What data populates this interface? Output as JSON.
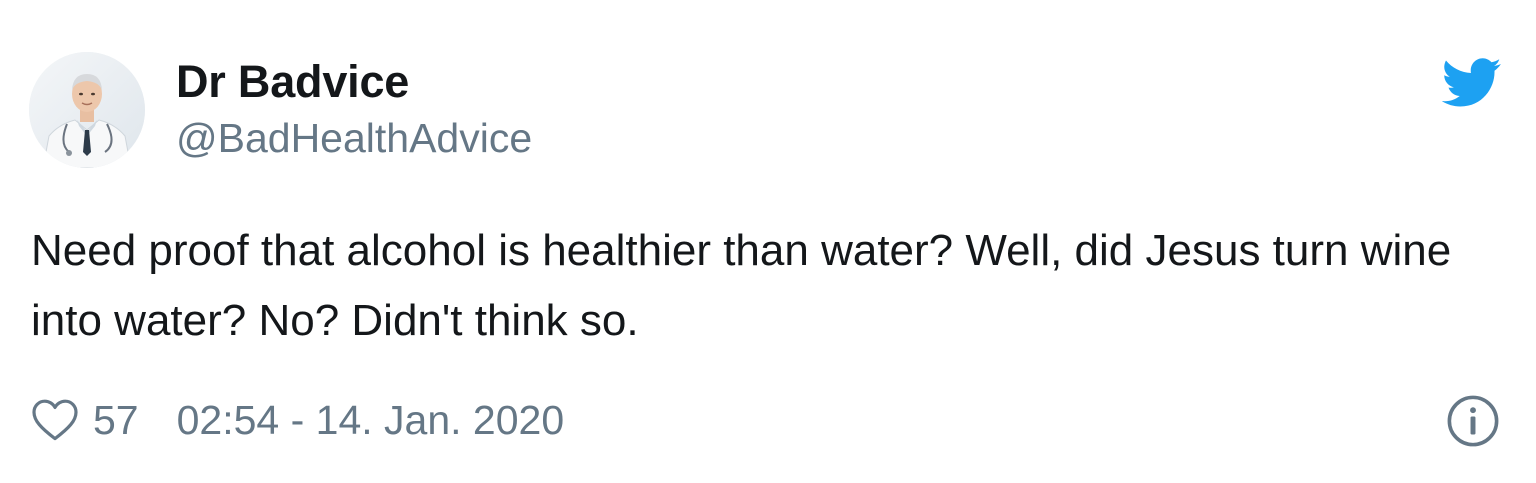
{
  "tweet": {
    "author": {
      "display_name": "Dr Badvice",
      "handle": "@BadHealthAdvice",
      "avatar_icon": "doctor-avatar-photo"
    },
    "text": "Need proof that alcohol is healthier than water? Well, did Jesus turn wine into water? No? Didn't think so.",
    "likes": "57",
    "timestamp": "02:54 - 14. Jan. 2020",
    "icons": {
      "brand": "twitter-bird-icon",
      "like": "heart-icon",
      "info": "info-icon"
    },
    "colors": {
      "brand_blue": "#1da1f2",
      "text_primary": "#14171a",
      "text_secondary": "#657786"
    }
  }
}
